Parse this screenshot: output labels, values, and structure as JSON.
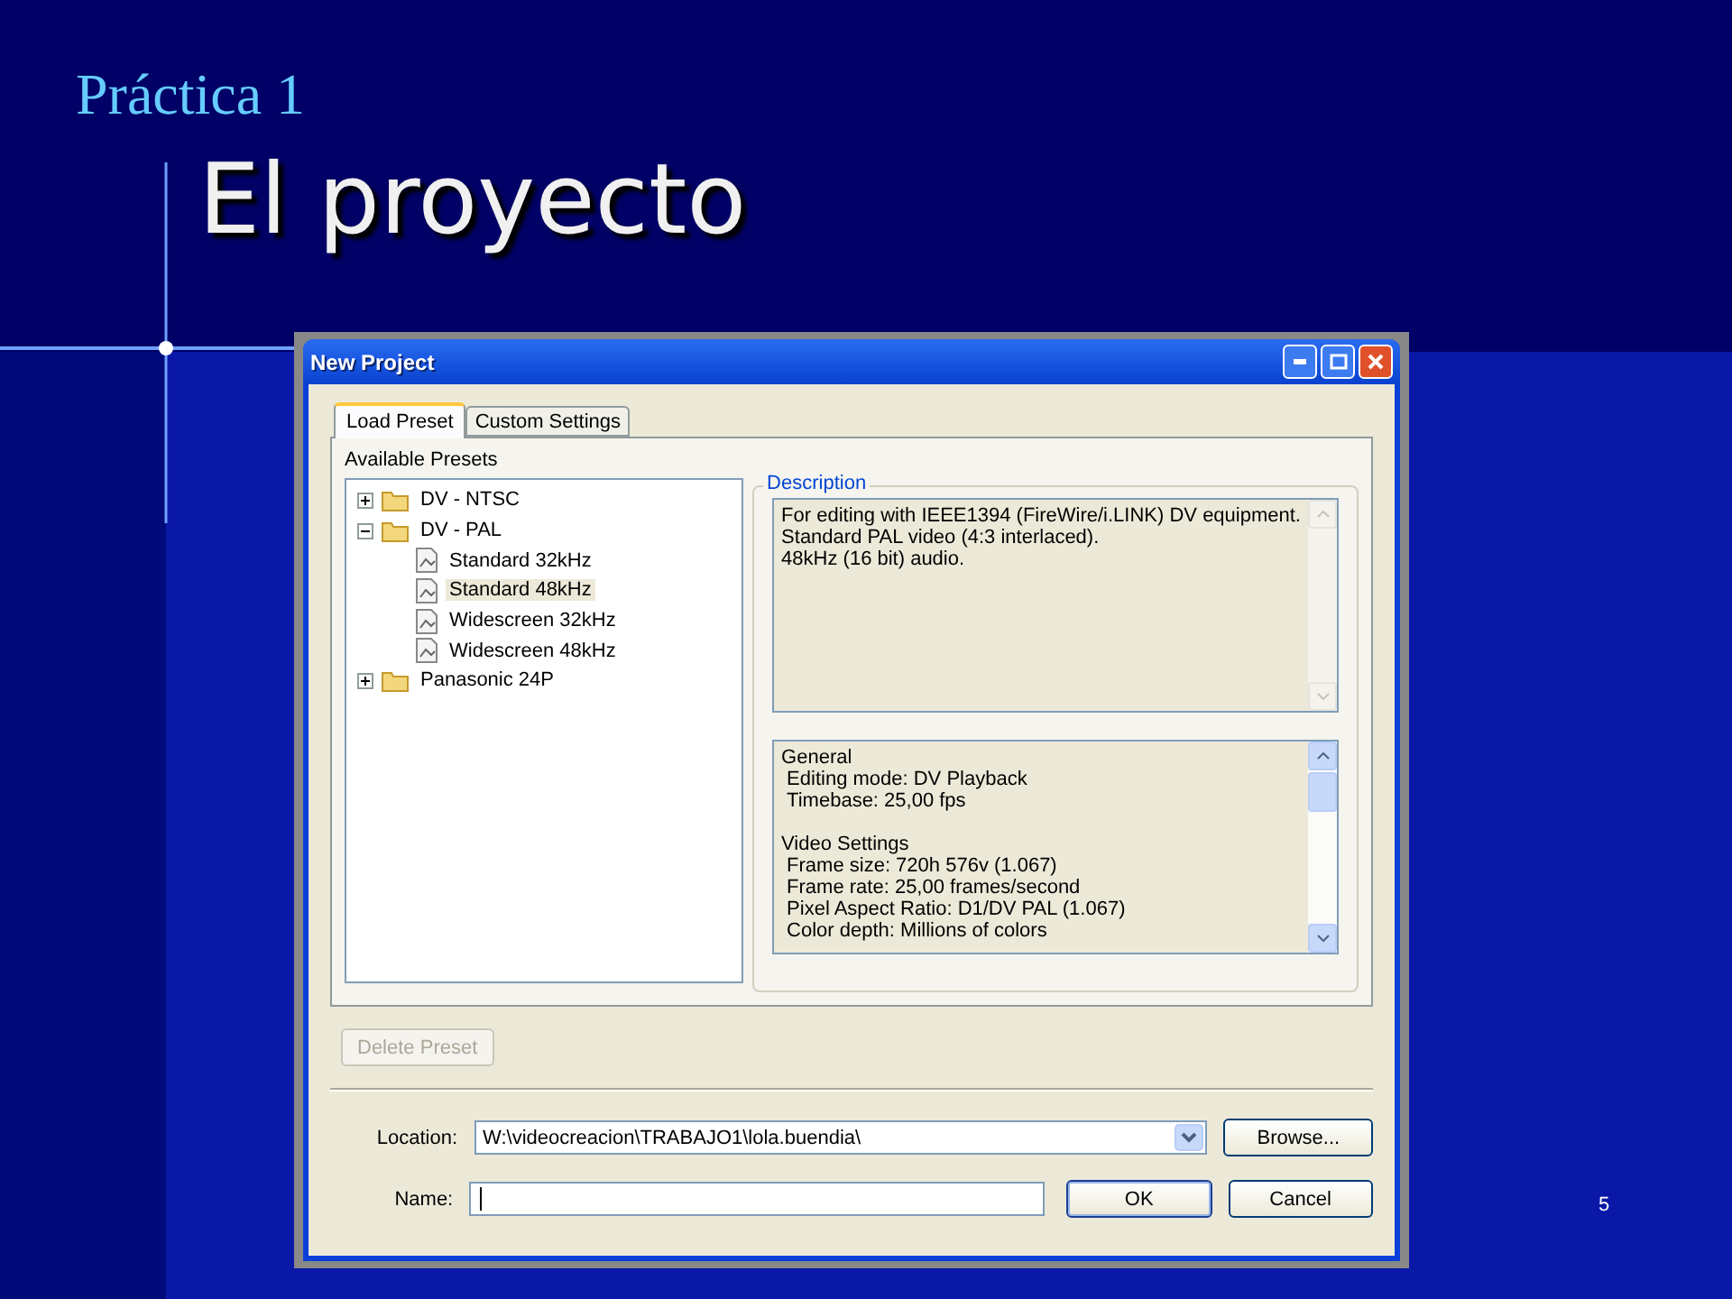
{
  "slide": {
    "subtitle": "Práctica 1",
    "title": "El proyecto",
    "page_number": "5"
  },
  "dialog": {
    "title": "New Project",
    "tabs": [
      {
        "label": "Load Preset",
        "selected": true
      },
      {
        "label": "Custom Settings",
        "selected": false
      }
    ],
    "presets_label": "Available Presets",
    "tree": [
      {
        "label": "DV - NTSC",
        "kind": "folder",
        "expanded": false,
        "selected": false
      },
      {
        "label": "DV - PAL",
        "kind": "folder",
        "expanded": true,
        "selected": false,
        "children": [
          {
            "label": "Standard 32kHz",
            "kind": "preset",
            "selected": false
          },
          {
            "label": "Standard 48kHz",
            "kind": "preset",
            "selected": true
          },
          {
            "label": "Widescreen 32kHz",
            "kind": "preset",
            "selected": false
          },
          {
            "label": "Widescreen 48kHz",
            "kind": "preset",
            "selected": false
          }
        ]
      },
      {
        "label": "Panasonic 24P",
        "kind": "folder",
        "expanded": false,
        "selected": false
      }
    ],
    "description_label": "Description",
    "description": [
      "For editing with IEEE1394 (FireWire/i.LINK) DV equipment.",
      "Standard PAL video (4:3 interlaced).",
      "48kHz (16 bit) audio."
    ],
    "details": [
      {
        "heading": "General",
        "items": [
          "Editing mode: DV Playback",
          "Timebase: 25,00 fps"
        ]
      },
      {
        "heading": "Video Settings",
        "items": [
          "Frame size: 720h 576v (1.067)",
          "Frame rate: 25,00 frames/second",
          "Pixel Aspect Ratio: D1/DV PAL (1.067)",
          "Color depth: Millions of colors"
        ]
      }
    ],
    "delete_button": {
      "label": "Delete Preset",
      "disabled": true
    },
    "location": {
      "label": "Location:",
      "value": "W:\\videocreacion\\TRABAJO1\\lola.buendia\\"
    },
    "name": {
      "label": "Name:"
    },
    "buttons": {
      "browse": "Browse...",
      "ok": "OK",
      "cancel": "Cancel"
    }
  }
}
